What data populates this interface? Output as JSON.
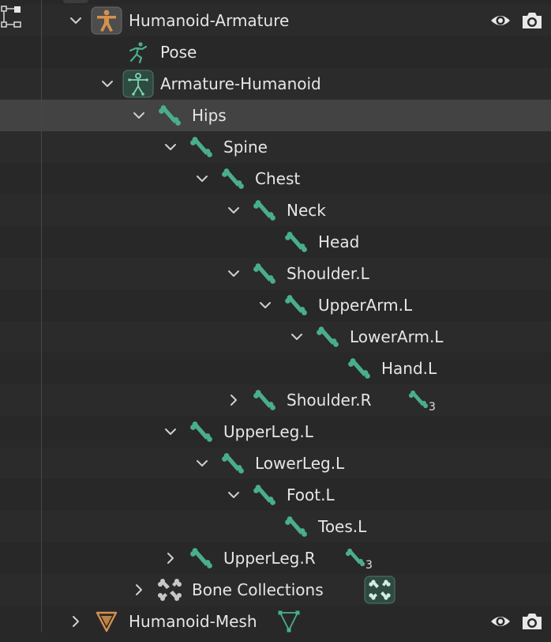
{
  "outliner": {
    "colors": {
      "bone": "#4aae8c",
      "armature_obj": "#d6914c",
      "mesh_obj": "#d6914c",
      "selected_row": "#434343",
      "text": "#e6e6e6"
    },
    "rows": [
      {
        "label": "Humanoid-Armature",
        "icon": "armature-object-icon",
        "depth": 0,
        "disclosure": "expanded",
        "visibility_icon": "eye-icon",
        "render_icon": "camera-icon"
      },
      {
        "label": "Pose",
        "icon": "pose-icon",
        "depth": 1,
        "disclosure": "none"
      },
      {
        "label": "Armature-Humanoid",
        "icon": "armature-data-icon",
        "depth": 1,
        "disclosure": "expanded"
      },
      {
        "label": "Hips",
        "icon": "bone-icon",
        "depth": 2,
        "disclosure": "expanded",
        "selected": true
      },
      {
        "label": "Spine",
        "icon": "bone-icon",
        "depth": 3,
        "disclosure": "expanded"
      },
      {
        "label": "Chest",
        "icon": "bone-icon",
        "depth": 4,
        "disclosure": "expanded"
      },
      {
        "label": "Neck",
        "icon": "bone-icon",
        "depth": 5,
        "disclosure": "expanded"
      },
      {
        "label": "Head",
        "icon": "bone-icon",
        "depth": 6,
        "disclosure": "none"
      },
      {
        "label": "Shoulder.L",
        "icon": "bone-icon",
        "depth": 5,
        "disclosure": "expanded"
      },
      {
        "label": "UpperArm.L",
        "icon": "bone-icon",
        "depth": 6,
        "disclosure": "expanded"
      },
      {
        "label": "LowerArm.L",
        "icon": "bone-icon",
        "depth": 7,
        "disclosure": "expanded"
      },
      {
        "label": "Hand.L",
        "icon": "bone-icon",
        "depth": 8,
        "disclosure": "none"
      },
      {
        "label": "Shoulder.R",
        "icon": "bone-icon",
        "depth": 5,
        "disclosure": "collapsed",
        "child_count": "3"
      },
      {
        "label": "UpperLeg.L",
        "icon": "bone-icon",
        "depth": 3,
        "disclosure": "expanded"
      },
      {
        "label": "LowerLeg.L",
        "icon": "bone-icon",
        "depth": 4,
        "disclosure": "expanded"
      },
      {
        "label": "Foot.L",
        "icon": "bone-icon",
        "depth": 5,
        "disclosure": "expanded"
      },
      {
        "label": "Toes.L",
        "icon": "bone-icon",
        "depth": 6,
        "disclosure": "none"
      },
      {
        "label": "UpperLeg.R",
        "icon": "bone-icon",
        "depth": 3,
        "disclosure": "collapsed",
        "child_count": "3"
      },
      {
        "label": "Bone Collections",
        "icon": "bone-collections-icon",
        "depth": 2,
        "disclosure": "collapsed",
        "collapsed_child_icon": "bone-collection-data-icon"
      },
      {
        "label": "Humanoid-Mesh",
        "icon": "mesh-object-icon",
        "depth": 0,
        "disclosure": "collapsed",
        "collapsed_child_icon": "mesh-data-icon",
        "visibility_icon": "eye-icon",
        "render_icon": "camera-icon"
      }
    ]
  }
}
